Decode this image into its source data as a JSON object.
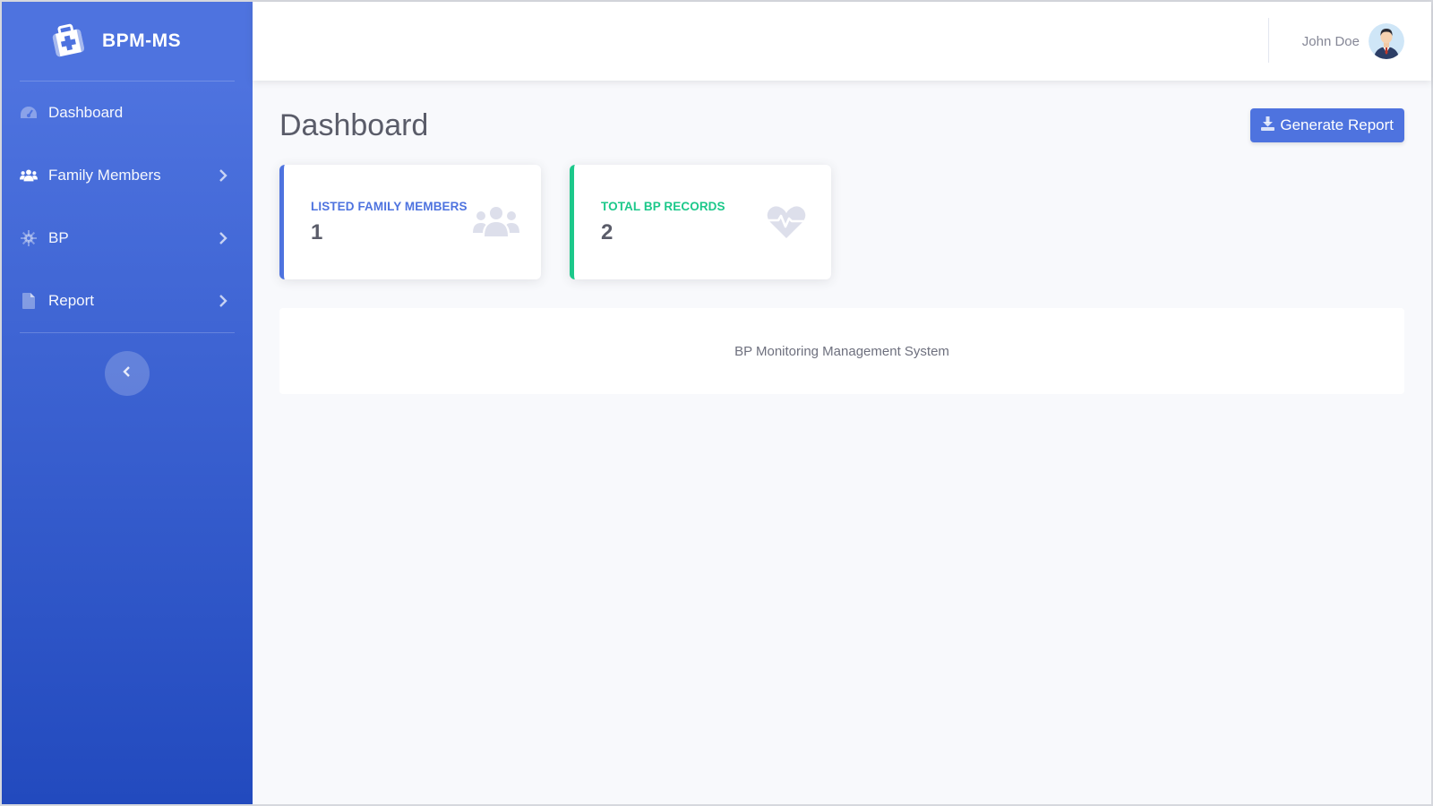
{
  "brand": {
    "name": "BPM-MS",
    "icon": "medical-kit-icon"
  },
  "sidebar": {
    "items": [
      {
        "label": "Dashboard",
        "icon": "tachometer-icon",
        "has_children": false
      },
      {
        "label": "Family Members",
        "icon": "users-icon",
        "has_children": true
      },
      {
        "label": "BP",
        "icon": "gear-icon",
        "has_children": true
      },
      {
        "label": "Report",
        "icon": "file-icon",
        "has_children": true
      }
    ],
    "toggle_icon": "chevron-left-icon"
  },
  "topbar": {
    "user_name": "John Doe",
    "avatar_icon": "user-avatar"
  },
  "page": {
    "title": "Dashboard",
    "generate_button": "Generate Report",
    "generate_icon": "download-icon"
  },
  "cards": [
    {
      "title": "LISTED FAMILY MEMBERS",
      "value": "1",
      "icon": "users-icon",
      "accent": "#4e73df"
    },
    {
      "title": "TOTAL BP RECORDS",
      "value": "2",
      "icon": "heartbeat-icon",
      "accent": "#1cc88a"
    }
  ],
  "footer": {
    "text": "BP Monitoring Management System"
  },
  "colors": {
    "primary": "#4e73df",
    "success": "#1cc88a",
    "sidebar_bottom": "#224abe",
    "background": "#f8f9fc"
  }
}
